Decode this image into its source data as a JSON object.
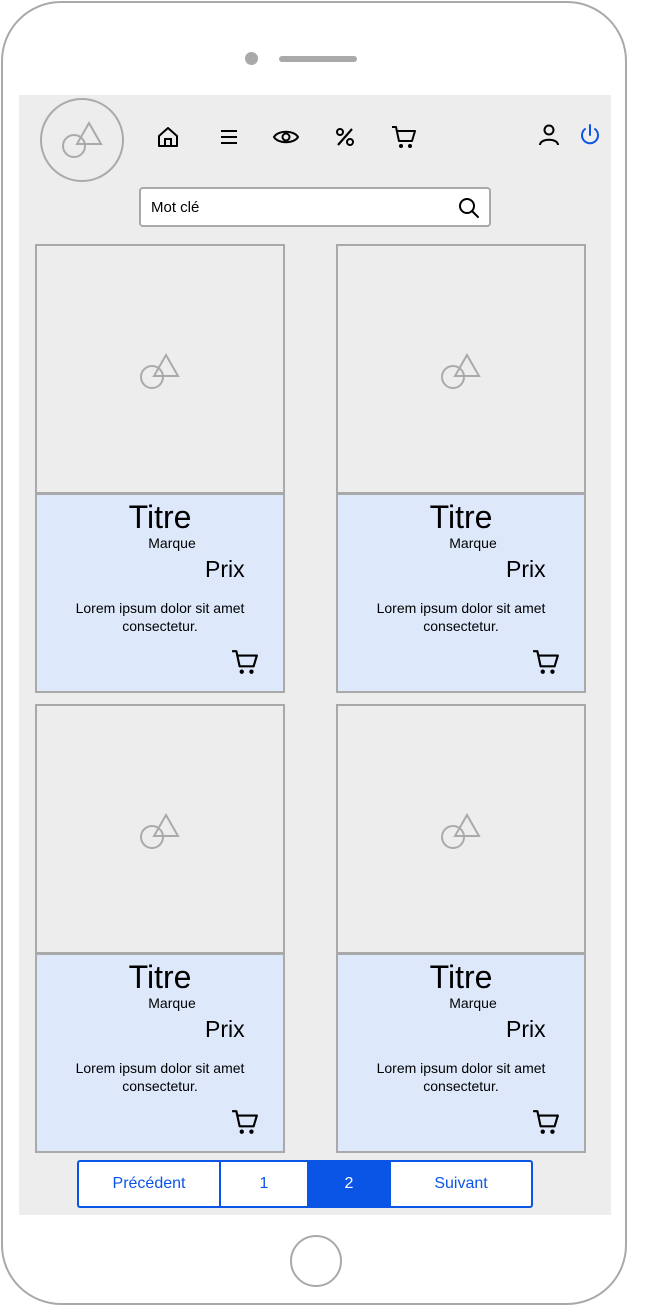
{
  "search": {
    "placeholder": "Mot clé"
  },
  "nav": {
    "icons": [
      "home-icon",
      "menu-icon",
      "eye-icon",
      "percent-icon",
      "cart-icon",
      "user-icon",
      "power-icon"
    ]
  },
  "products": [
    {
      "title": "Titre",
      "brand": "Marque",
      "price": "Prix",
      "description": "Lorem ipsum dolor sit amet consectetur."
    },
    {
      "title": "Titre",
      "brand": "Marque",
      "price": "Prix",
      "description": "Lorem ipsum dolor sit amet consectetur."
    },
    {
      "title": "Titre",
      "brand": "Marque",
      "price": "Prix",
      "description": "Lorem ipsum dolor sit amet consectetur."
    },
    {
      "title": "Titre",
      "brand": "Marque",
      "price": "Prix",
      "description": "Lorem ipsum dolor sit amet consectetur."
    }
  ],
  "pagination": {
    "previous": "Précédent",
    "pages": [
      "1",
      "2"
    ],
    "current": "2",
    "next": "Suivant"
  },
  "colors": {
    "accent": "#0b55e6",
    "card_body": "#dde8fb",
    "screen_bg": "#ededed",
    "border": "#a9a9a9"
  }
}
